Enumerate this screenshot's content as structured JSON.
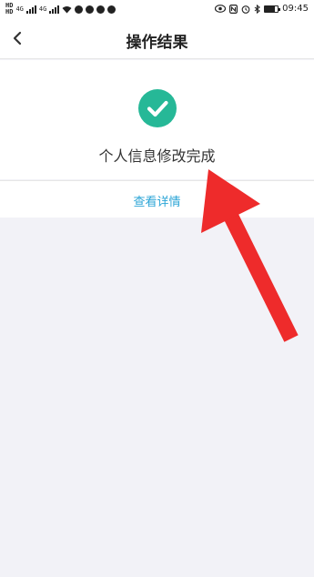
{
  "status_bar": {
    "hd_top": "HD",
    "hd_bottom": "HD",
    "network_1": "4G",
    "network_2": "4G",
    "time": "09:45",
    "battery_level": 0.8
  },
  "nav": {
    "back_icon": "chevron-left-icon",
    "title": "操作结果"
  },
  "result": {
    "status_icon": "check-circle-icon",
    "message": "个人信息修改完成",
    "success_color": "#26b897"
  },
  "actions": {
    "view_details": "查看详情",
    "link_color": "#2aa4d6"
  },
  "annotation": {
    "arrow_color": "#ee2b2b"
  }
}
